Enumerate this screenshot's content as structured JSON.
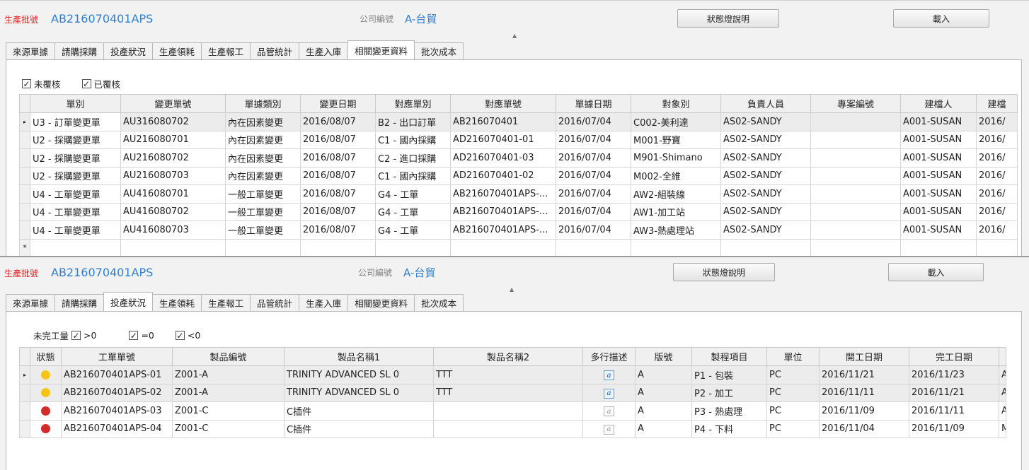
{
  "panel1": {
    "batch_label": "生產批號",
    "batch_value": "AB216070401APS",
    "company_label": "公司編號",
    "company_value": "A-台貿",
    "status_button": "狀態燈說明",
    "load_button": "載入",
    "collapse_icon": "triangle-up-icon",
    "tabs": [
      "來源單據",
      "請購採購",
      "投產狀況",
      "生產領耗",
      "生產報工",
      "品管統計",
      "生產入庫",
      "相關變更資料",
      "批次成本"
    ],
    "active_tab": "相關變更資料",
    "filters": [
      {
        "label": "未覆核",
        "checked": true
      },
      {
        "label": "已覆核",
        "checked": true
      }
    ],
    "grid": {
      "columns": [
        "單別",
        "變更單號",
        "單據類別",
        "變更日期",
        "對應單別",
        "對應單號",
        "單據日期",
        "對象別",
        "負責人員",
        "專案編號",
        "建檔人",
        "建檔"
      ],
      "rows": [
        [
          "U3 - 訂單變更單",
          "AU316080702",
          "內在因素變更",
          "2016/08/07",
          "B2 - 出口訂單",
          "AB216070401",
          "2016/07/04",
          "C002-美利達",
          "AS02-SANDY",
          "",
          "A001-SUSAN",
          "2016/"
        ],
        [
          "U2 - 採購變更單",
          "AU216080701",
          "內在因素變更",
          "2016/08/07",
          "C1 - 國內採購",
          "AD216070401-01",
          "2016/07/04",
          "M001-野寶",
          "AS02-SANDY",
          "",
          "A001-SUSAN",
          "2016/"
        ],
        [
          "U2 - 採購變更單",
          "AU216080702",
          "內在因素變更",
          "2016/08/07",
          "C2 - 進口採購",
          "AD216070401-03",
          "2016/07/04",
          "M901-Shimano",
          "AS02-SANDY",
          "",
          "A001-SUSAN",
          "2016/"
        ],
        [
          "U2 - 採購變更單",
          "AU216080703",
          "內在因素變更",
          "2016/08/07",
          "C1 - 國內採購",
          "AD216070401-02",
          "2016/07/04",
          "M002-全維",
          "AS02-SANDY",
          "",
          "A001-SUSAN",
          "2016/"
        ],
        [
          "U4 - 工單變更單",
          "AU416080701",
          "一般工單變更",
          "2016/08/07",
          "G4 - 工單",
          "AB216070401APS-...",
          "2016/07/04",
          "AW2-組裝線",
          "AS02-SANDY",
          "",
          "A001-SUSAN",
          "2016/"
        ],
        [
          "U4 - 工單變更單",
          "AU416080702",
          "一般工單變更",
          "2016/08/07",
          "G4 - 工單",
          "AB216070401APS-...",
          "2016/07/04",
          "AW1-加工站",
          "AS02-SANDY",
          "",
          "A001-SUSAN",
          "2016/"
        ],
        [
          "U4 - 工單變更單",
          "AU416080703",
          "一般工單變更",
          "2016/08/07",
          "G4 - 工單",
          "AB216070401APS-...",
          "2016/07/04",
          "AW3-熱處理站",
          "AS02-SANDY",
          "",
          "A001-SUSAN",
          "2016/"
        ]
      ],
      "row_selected_marker": "▸",
      "new_row_marker": "*"
    }
  },
  "panel2": {
    "batch_label": "生產批號",
    "batch_value": "AB216070401APS",
    "company_label": "公司編號",
    "company_value": "A-台貿",
    "status_button": "狀態燈說明",
    "load_button": "載入",
    "collapse_icon": "triangle-up-icon",
    "tabs": [
      "來源單據",
      "請購採購",
      "投產狀況",
      "生產領耗",
      "生產報工",
      "品管統計",
      "生產入庫",
      "相關變更資料",
      "批次成本"
    ],
    "active_tab": "投產狀況",
    "filter_label": "未完工量",
    "filters": [
      {
        "label": ">0",
        "checked": true
      },
      {
        "label": "=0",
        "checked": true
      },
      {
        "label": "<0",
        "checked": true
      }
    ],
    "grid": {
      "columns": [
        "狀態",
        "工單單號",
        "製品編號",
        "製品名稱1",
        "製品名稱2",
        "多行描述",
        "版號",
        "製程項目",
        "單位",
        "開工日期",
        "完工日期",
        ""
      ],
      "rows": [
        {
          "status_color": "#f5c518",
          "cells": [
            "AB216070401APS-01",
            "Z001-A",
            "TRINITY ADVANCED SL 0",
            "TTT",
            "",
            "A",
            "P1 - 包裝",
            "PC",
            "2016/11/21",
            "2016/11/23",
            "AV"
          ],
          "memo": "filled"
        },
        {
          "status_color": "#f5c518",
          "cells": [
            "AB216070401APS-02",
            "Z001-A",
            "TRINITY ADVANCED SL 0",
            "TTT",
            "",
            "A",
            "P2 - 加工",
            "PC",
            "2016/11/11",
            "2016/11/21",
            "AV"
          ],
          "memo": "filled"
        },
        {
          "status_color": "#d42a2a",
          "cells": [
            "AB216070401APS-03",
            "Z001-C",
            "C插件",
            "",
            "",
            "A",
            "P3 - 熱處理",
            "PC",
            "2016/11/09",
            "2016/11/11",
            "AV"
          ],
          "memo": "empty"
        },
        {
          "status_color": "#d42a2a",
          "cells": [
            "AB216070401APS-04",
            "Z001-C",
            "C插件",
            "",
            "",
            "A",
            "P4 - 下料",
            "PC",
            "2016/11/04",
            "2016/11/09",
            "M"
          ],
          "memo": "empty"
        }
      ],
      "row_selected_marker": "▸",
      "memo_glyph": "a"
    }
  },
  "colors": {
    "batch_label": "#e02020",
    "batch_value": "#2f7fd0",
    "status_yellow": "#f5c518",
    "status_red": "#d42a2a"
  }
}
